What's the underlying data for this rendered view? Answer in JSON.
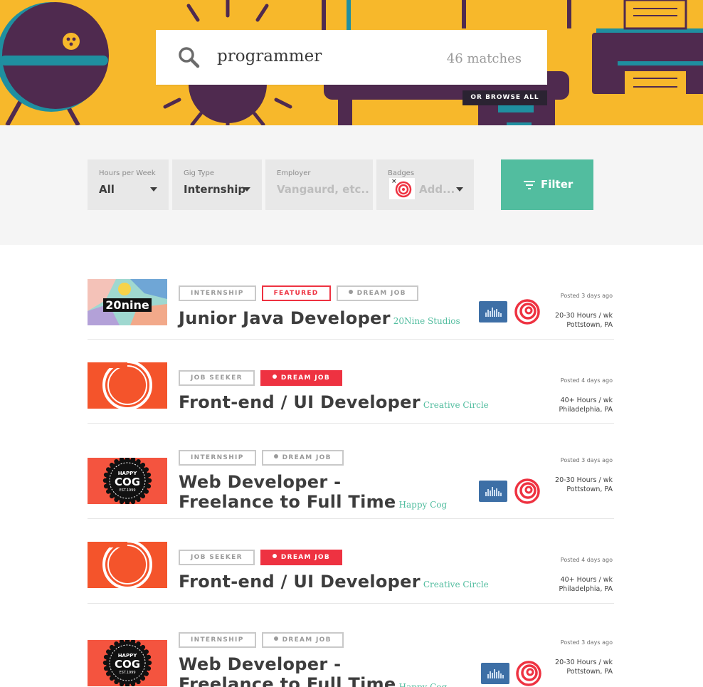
{
  "search": {
    "query": "programmer",
    "matches": "46 matches",
    "browse_all": "OR BROWSE ALL"
  },
  "filters": {
    "hours": {
      "label": "Hours per Week",
      "value": "All"
    },
    "gig": {
      "label": "Gig Type",
      "value": "Internship"
    },
    "employer": {
      "label": "Employer",
      "placeholder": "Vangaurd, etc.."
    },
    "badges": {
      "label": "Badges",
      "placeholder": "Add...",
      "remove": "×"
    },
    "button": "Filter"
  },
  "colors": {
    "hero": "#f7b82b",
    "accent_green": "#52bd9f",
    "accent_red": "#ee3241",
    "purple": "#4f2a4f",
    "teal": "#1f8fa0"
  },
  "listings": [
    {
      "tags": [
        "INTERNSHIP",
        "FEATURED",
        "DREAM JOB"
      ],
      "title_line1": "Junior Java Developer",
      "title_line2": "",
      "company": "20Nine Studios",
      "logo": "20nine",
      "posted": "Posted 3 days ago",
      "hours": "20-30 Hours / wk",
      "location": "Pottstown, PA",
      "badges": true
    },
    {
      "tags": [
        "JOB SEEKER",
        "DREAM JOB"
      ],
      "title_line1": "Front-end / UI Developer",
      "title_line2": "",
      "company": "Creative Circle",
      "logo": "creative-circle",
      "posted": "Posted 4 days ago",
      "hours": "40+ Hours / wk",
      "location": "Philadelphia, PA",
      "badges": false
    },
    {
      "tags": [
        "INTERNSHIP",
        "DREAM JOB"
      ],
      "title_line1": "Web Developer -",
      "title_line2": "Freelance to Full Time",
      "company": "Happy Cog",
      "logo": "happy-cog",
      "posted": "Posted 3 days ago",
      "hours": "20-30 Hours / wk",
      "location": "Pottstown, PA",
      "badges": true
    },
    {
      "tags": [
        "JOB SEEKER",
        "DREAM JOB"
      ],
      "title_line1": "Front-end / UI Developer",
      "title_line2": "",
      "company": "Creative Circle",
      "logo": "creative-circle",
      "posted": "Posted 4 days ago",
      "hours": "40+ Hours / wk",
      "location": "Philadelphia, PA",
      "badges": false
    },
    {
      "tags": [
        "INTERNSHIP",
        "DREAM JOB"
      ],
      "title_line1": "Web Developer -",
      "title_line2": "Freelance to Full Time",
      "company": "Happy Cog",
      "logo": "happy-cog",
      "posted": "Posted 3 days ago",
      "hours": "20-30 Hours / wk",
      "location": "Pottstown, PA",
      "badges": true
    }
  ],
  "logo_text": {
    "twenty_nine": "20nine",
    "happy": "HAPPY",
    "cog": "COG",
    "est": "EST.1999"
  }
}
